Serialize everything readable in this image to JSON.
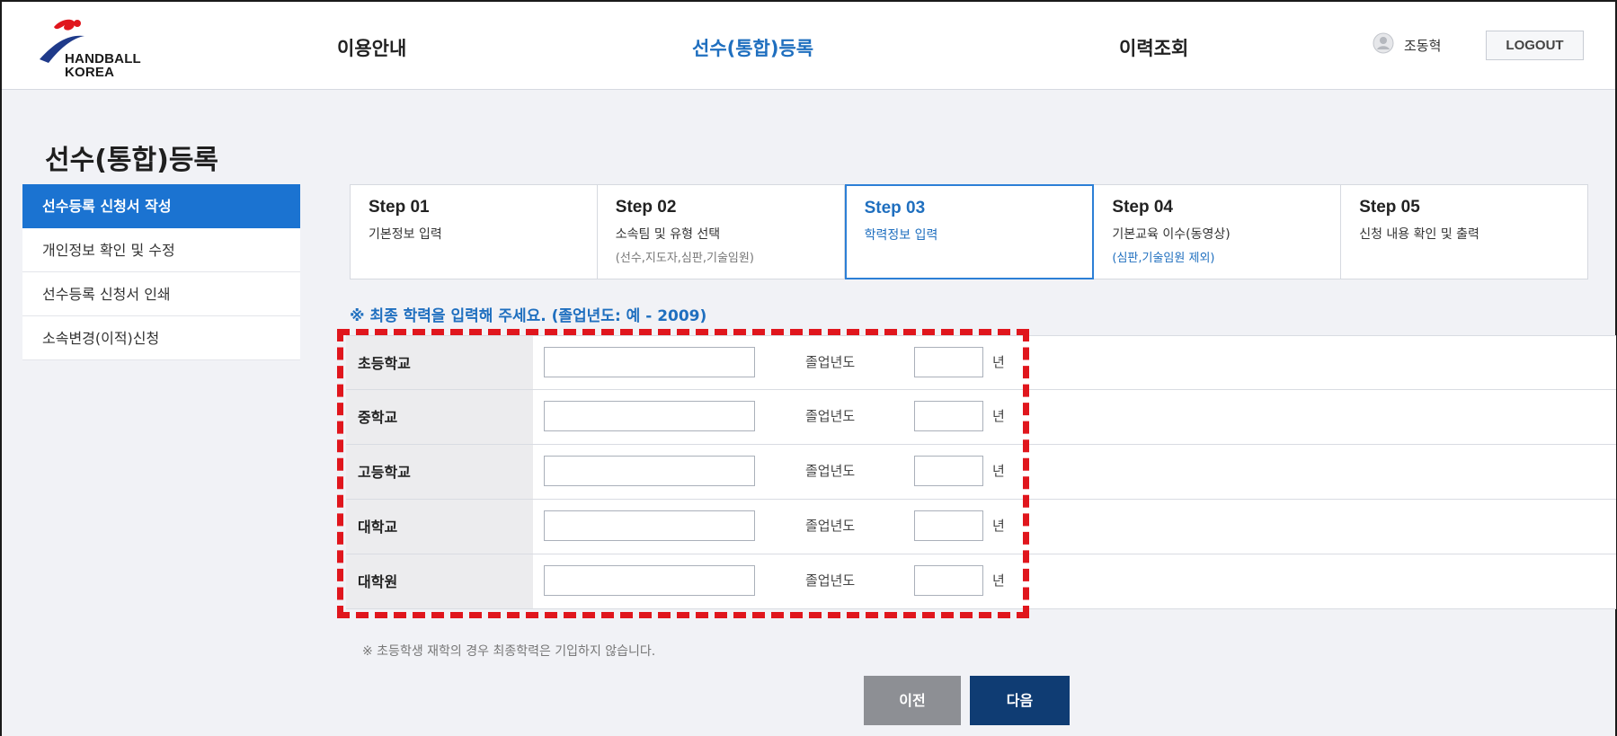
{
  "header": {
    "logo_text_line1": "HANDBALL",
    "logo_text_line2": "KOREA",
    "nav": [
      {
        "label": "이용안내",
        "active": false
      },
      {
        "label": "선수(통합)등록",
        "active": true
      },
      {
        "label": "이력조회",
        "active": false
      }
    ],
    "user_name": "조동혁",
    "logout_label": "LOGOUT"
  },
  "page_title": "선수(통합)등록",
  "sidebar": {
    "items": [
      {
        "label": "선수등록 신청서 작성",
        "active": true
      },
      {
        "label": "개인정보 확인 및 수정",
        "active": false
      },
      {
        "label": "선수등록 신청서 인쇄",
        "active": false
      },
      {
        "label": "소속변경(이적)신청",
        "active": false
      }
    ]
  },
  "steps": [
    {
      "num": "Step 01",
      "label": "기본정보 입력",
      "sub": ""
    },
    {
      "num": "Step 02",
      "label": "소속팀 및 유형 선택",
      "sub": "(선수,지도자,심판,기술임원)"
    },
    {
      "num": "Step 03",
      "label": "학력정보 입력",
      "sub": "",
      "active": true
    },
    {
      "num": "Step 04",
      "label": "기본교육 이수(동영상)",
      "sub": "(심판,기술임원 제외)"
    },
    {
      "num": "Step 05",
      "label": "신청 내용 확인 및 출력",
      "sub": ""
    }
  ],
  "notice": "※ 최종 학력을 입력해 주세요. (졸업년도: 예 - 2009)",
  "education": {
    "grad_label": "졸업년도",
    "year_unit": "년",
    "rows": [
      {
        "label": "초등학교",
        "school_value": "",
        "year_value": ""
      },
      {
        "label": "중학교",
        "school_value": "",
        "year_value": ""
      },
      {
        "label": "고등학교",
        "school_value": "",
        "year_value": ""
      },
      {
        "label": "대학교",
        "school_value": "",
        "year_value": ""
      },
      {
        "label": "대학원",
        "school_value": "",
        "year_value": ""
      }
    ]
  },
  "footnote": "※ 초등학생 재학의 경우 최종학력은 기입하지 않습니다.",
  "buttons": {
    "prev": "이전",
    "next": "다음"
  },
  "colors": {
    "accent": "#1b73d1",
    "active_text": "#1f6fbf",
    "highlight": "#e0161d",
    "next_button": "#0f3c73",
    "prev_button": "#8d8f94"
  }
}
